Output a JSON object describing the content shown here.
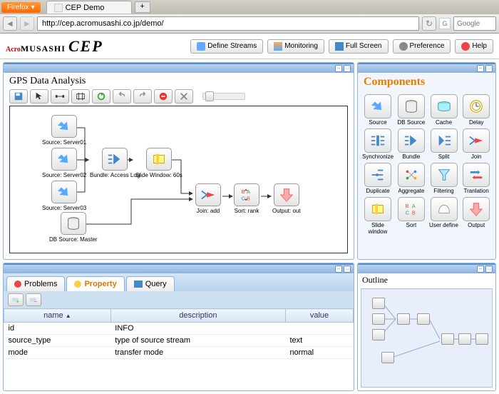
{
  "browser": {
    "firefox_label": "Firefox",
    "tab_title": "CEP Demo",
    "url": "http://cep.acromusashi.co.jp/demo/",
    "search_placeholder": "Google"
  },
  "header": {
    "logo_acro": "Acro",
    "logo_mus": "MUSASHI",
    "logo_cep": "CEP",
    "buttons": {
      "define": "Define Streams",
      "monitoring": "Monitoring",
      "fullscreen": "Full Screen",
      "preference": "Preference",
      "help": "Help"
    }
  },
  "canvas": {
    "title": "GPS Data Analysis",
    "nodes": {
      "src1": "Source: Server01",
      "src2": "Source: Server02",
      "src3": "Source: Server03",
      "dbsrc": "DB Source: Master",
      "bundle": "Bundle: Access Log",
      "slide": "Slide Window: 60s",
      "join": "Join: add",
      "sort": "Sort: rank",
      "output": "Output: out"
    }
  },
  "components": {
    "title": "Components",
    "items": [
      "Source",
      "DB Source",
      "Cache",
      "Delay",
      "Synchronize",
      "Bundle",
      "Split",
      "Join",
      "Duplicate",
      "Aggregate",
      "Filtering",
      "Tranlation",
      "Slide window",
      "Sort",
      "User define",
      "Output"
    ]
  },
  "tabs": {
    "problems": "Problems",
    "property": "Property",
    "query": "Query"
  },
  "table": {
    "cols": {
      "name": "name",
      "desc": "description",
      "value": "value"
    },
    "rows": [
      {
        "name": "id",
        "desc": "INFO",
        "value": ""
      },
      {
        "name": "source_type",
        "desc": "type of source stream",
        "value": "text"
      },
      {
        "name": "mode",
        "desc": "transfer mode",
        "value": "normal"
      }
    ]
  },
  "outline": {
    "title": "Outline"
  }
}
